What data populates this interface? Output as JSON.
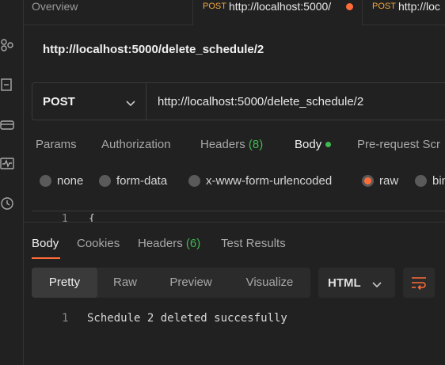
{
  "tabs": [
    {
      "label": "Overview"
    },
    {
      "method": "POST",
      "url": "http://localhost:5000/"
    },
    {
      "method": "POST",
      "url": "http://loc"
    }
  ],
  "page_title": "http://localhost:5000/delete_schedule/2",
  "request": {
    "method": "POST",
    "url": "http://localhost:5000/delete_schedule/2"
  },
  "request_tabs": {
    "params": "Params",
    "authorization": "Authorization",
    "headers": "Headers",
    "headers_count": "(8)",
    "body": "Body",
    "pre_request": "Pre-request Scr"
  },
  "body_types": {
    "none": "none",
    "form_data": "form-data",
    "urlencoded": "x-www-form-urlencoded",
    "raw": "raw",
    "binary": "bin",
    "selected": "raw"
  },
  "editor": {
    "line": "1",
    "text": "{"
  },
  "response_tabs": {
    "body": "Body",
    "cookies": "Cookies",
    "headers": "Headers",
    "headers_count": "(6)",
    "test_results": "Test Results"
  },
  "view_modes": {
    "pretty": "Pretty",
    "raw": "Raw",
    "preview": "Preview",
    "visualize": "Visualize",
    "format": "HTML"
  },
  "response_body": {
    "line": "1",
    "text": "Schedule 2 deleted succesfully"
  },
  "colors": {
    "accent": "#ff6c37",
    "method_post": "#f0a741",
    "count_green": "#3fb950"
  },
  "sidebar_icons": [
    "network-icon",
    "collection-icon",
    "environment-icon",
    "monitor-icon",
    "history-icon"
  ]
}
